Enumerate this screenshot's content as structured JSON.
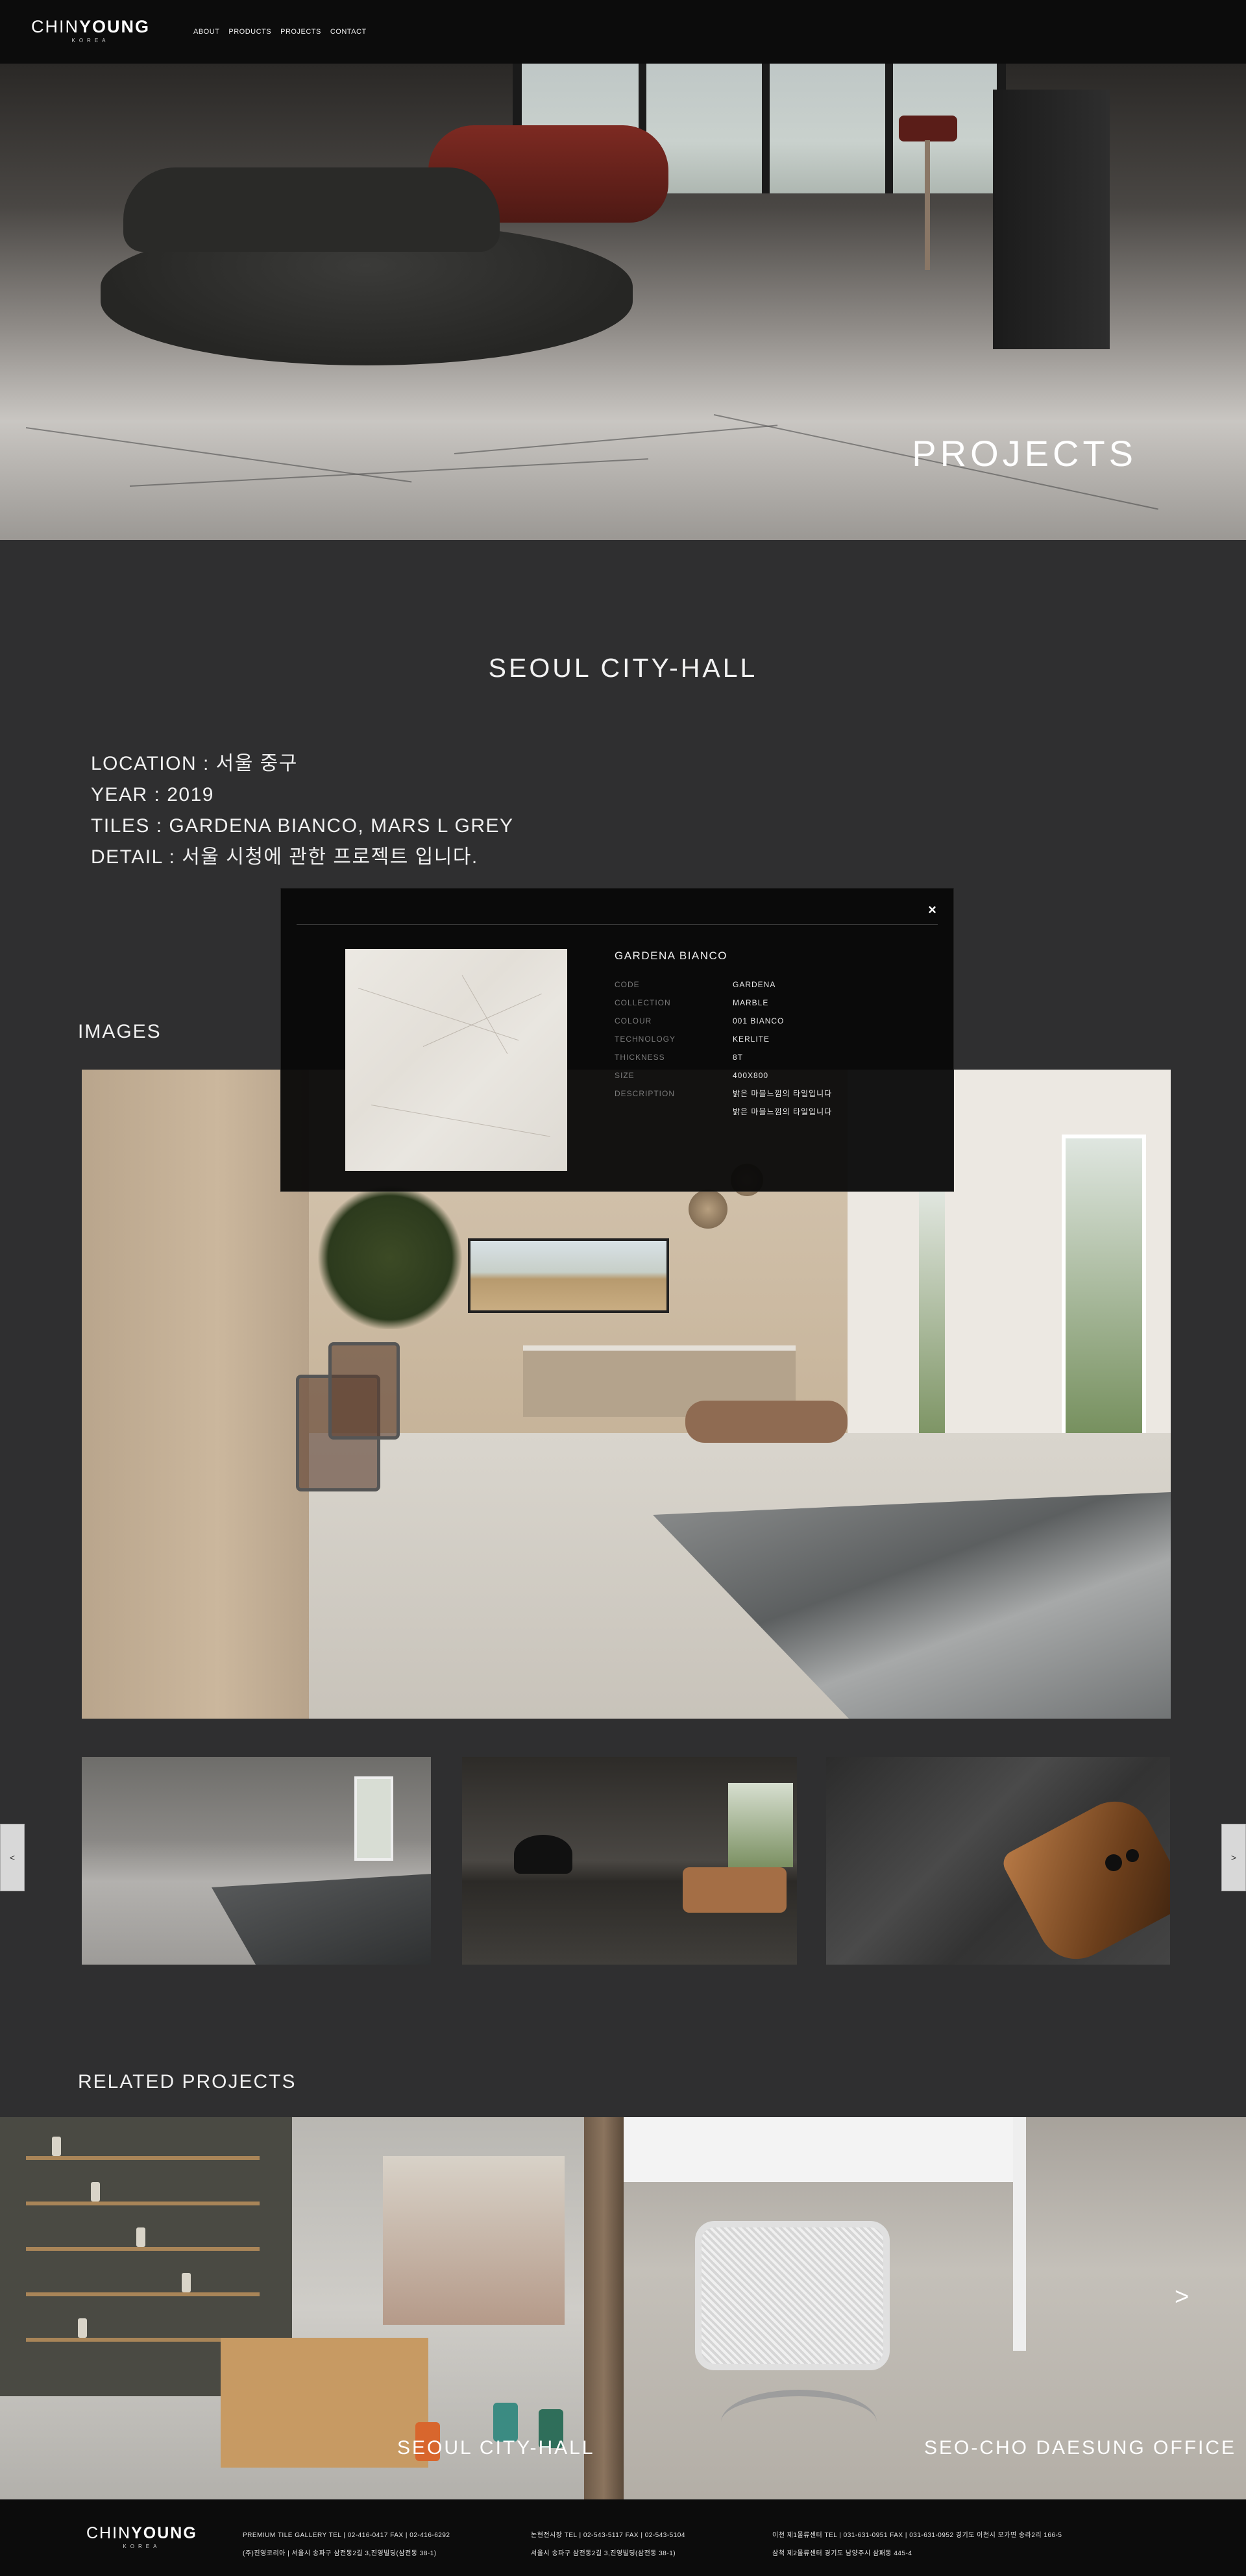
{
  "header": {
    "logo_main_a": "CHIN",
    "logo_main_b": "YOUNG",
    "logo_sub": "KOREA",
    "nav": [
      "ABOUT",
      "PRODUCTS",
      "PROJECTS",
      "CONTACT"
    ]
  },
  "hero": {
    "title": "PROJECTS"
  },
  "project": {
    "title": "SEOUL CITY-HALL",
    "location": "LOCATION : 서울 중구",
    "year": "YEAR : 2019",
    "tiles": "TILES : GARDENA BIANCO, MARS L GREY",
    "detail": "DETAIL : 서울 시청에 관한 프로젝트 입니다."
  },
  "images": {
    "label": "IMAGES",
    "prev": "<",
    "next": ">"
  },
  "popup": {
    "close": "×",
    "name": "GARDENA BIANCO",
    "specs": [
      {
        "key": "CODE",
        "value": "GARDENA"
      },
      {
        "key": "COLLECTION",
        "value": "MARBLE"
      },
      {
        "key": "COLOUR",
        "value": "001 BIANCO"
      },
      {
        "key": "TECHNOLOGY",
        "value": "KERLITE"
      },
      {
        "key": "THICKNESS",
        "value": "8T"
      },
      {
        "key": "SIZE",
        "value": "400X800"
      },
      {
        "key": "DESCRIPTION",
        "value": "밝은 마블느낌의 타일입니다"
      },
      {
        "key": "",
        "value": "밝은 마블느낌의 타일입니다"
      }
    ]
  },
  "related": {
    "label": "RELATED PROJECTS",
    "items": [
      {
        "title": "SEOUL CITY-HALL"
      },
      {
        "title": "SEO-CHO DAESUNG OFFICE"
      }
    ],
    "next": ">"
  },
  "footer": {
    "logo_main_a": "CHIN",
    "logo_main_b": "YOUNG",
    "logo_sub": "KOREA",
    "col1_line1": "PREMIUM TILE GALLERY    TEL | 02-416-0417    FAX | 02-416-6292",
    "col1_line2": "(주)진영코리아 | 서울시 송파구 삼전동2길 3,진영빌딩(삼전동 38-1)",
    "col2_line1": "논현전시장    TEL | 02-543-5117    FAX | 02-543-5104",
    "col2_line2": "서울시 송파구 삼전동2길 3,진영빌딩(삼전동 38-1)",
    "col3_line1": "이천 제1물류센터    TEL | 031-631-0951    FAX | 031-631-0952    경기도 이천시 모가면 송라2리 166-5",
    "col3_line2": "삼척 제2물류센터    경기도 남양주시 삼패동 445-4"
  },
  "colors": {
    "header_bg": "#0c0c0c",
    "page_bg": "#2f2f30",
    "popup_bg": "#080808",
    "text": "#f0f0f0",
    "muted": "#7a7a7a"
  }
}
